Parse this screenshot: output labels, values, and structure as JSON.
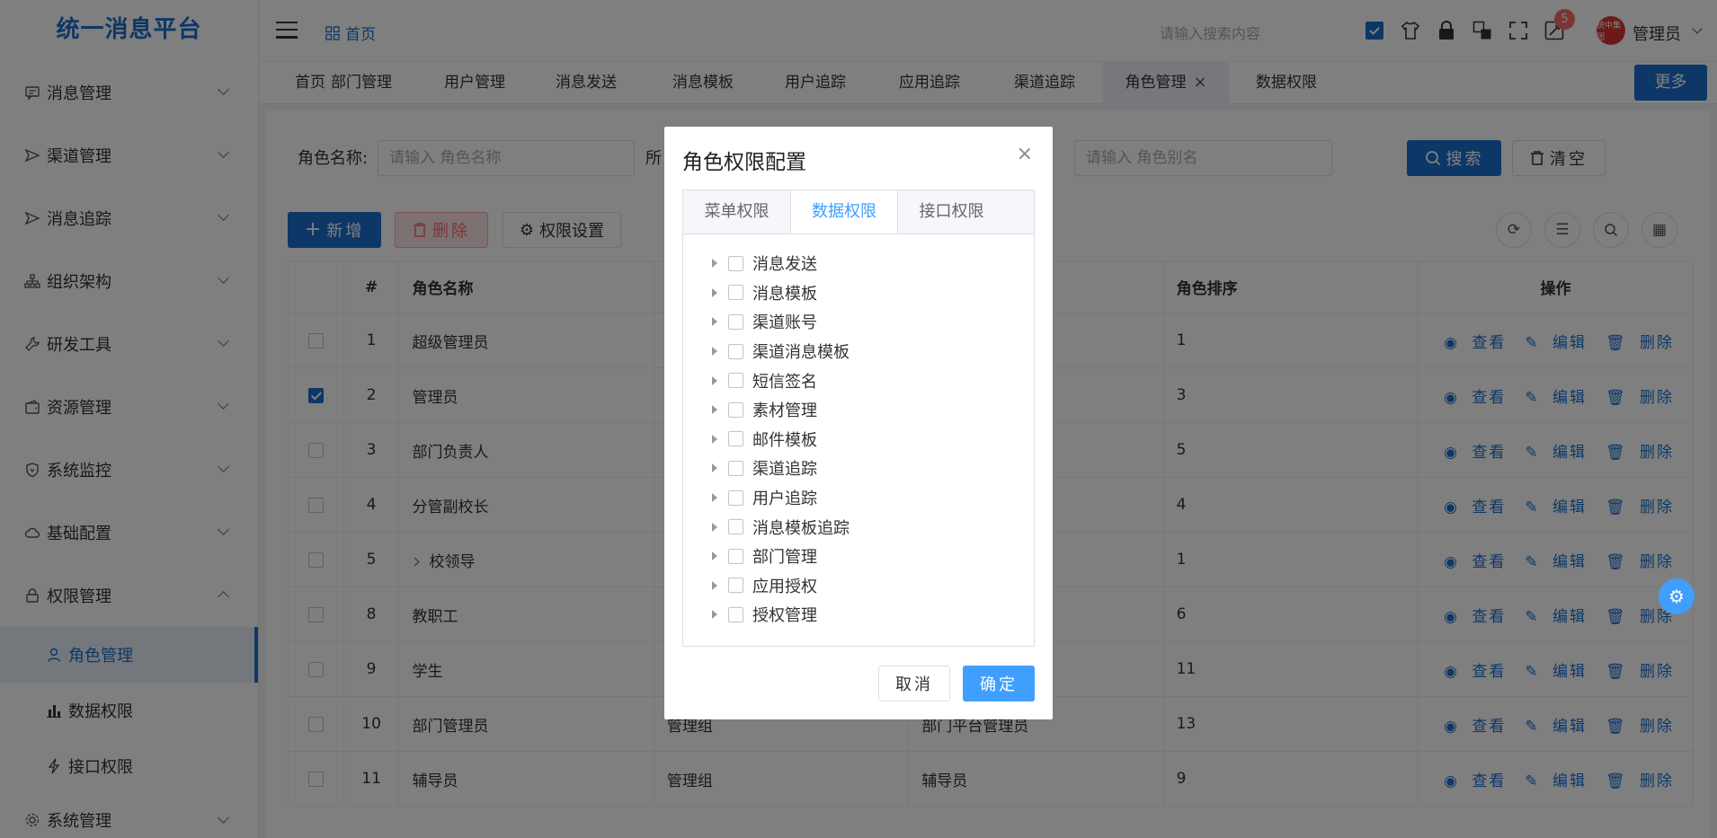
{
  "app": {
    "title": "统一消息平台"
  },
  "sidebar": {
    "items": [
      {
        "label": "消息管理",
        "icon": "message-icon"
      },
      {
        "label": "渠道管理",
        "icon": "send-icon"
      },
      {
        "label": "消息追踪",
        "icon": "send-icon"
      },
      {
        "label": "组织架构",
        "icon": "org-icon"
      },
      {
        "label": "研发工具",
        "icon": "wrench-icon"
      },
      {
        "label": "资源管理",
        "icon": "wallet-icon"
      },
      {
        "label": "系统监控",
        "icon": "shield-icon"
      },
      {
        "label": "基础配置",
        "icon": "cloud-icon"
      },
      {
        "label": "权限管理",
        "icon": "lock-icon"
      }
    ],
    "sub_items": [
      {
        "label": "角色管理",
        "icon": "user-icon"
      },
      {
        "label": "数据权限",
        "icon": "bar-chart-icon"
      },
      {
        "label": "接口权限",
        "icon": "lightning-icon"
      }
    ],
    "last_item": {
      "label": "系统管理",
      "icon": "gear-icon"
    }
  },
  "header": {
    "breadcrumb": "首页",
    "search_placeholder": "请输入搜索内容",
    "notification_count": "5",
    "avatar_text": "统中集团",
    "user_name": "管理员"
  },
  "tabs": {
    "items": [
      "首页",
      "部门管理",
      "用户管理",
      "消息发送",
      "消息模板",
      "用户追踪",
      "应用追踪",
      "渠道追踪",
      "角色管理",
      "数据权限"
    ],
    "active": "角色管理",
    "close_glyph": "×",
    "more_label": "更多"
  },
  "search_form": {
    "role_name_label": "角色名称:",
    "role_name_placeholder": "请输入 角色名称",
    "group_label_partial": "所",
    "alias_label_partial": "名:",
    "alias_placeholder": "请输入 角色别名",
    "search_label": "搜索",
    "clear_label": "清空"
  },
  "toolbar": {
    "add_label": "新增",
    "delete_label": "删除",
    "permission_label": "权限设置"
  },
  "table": {
    "headers": {
      "index": "#",
      "role_name": "角色名称",
      "sort": "角色排序",
      "ops": "操作"
    },
    "rows": [
      {
        "idx": "1",
        "name": "超级管理员",
        "group": "",
        "alias": "",
        "sort": "1",
        "checked": false
      },
      {
        "idx": "2",
        "name": "管理员",
        "group": "",
        "alias": "",
        "sort": "3",
        "checked": true
      },
      {
        "idx": "3",
        "name": "部门负责人",
        "group": "",
        "alias": "",
        "sort": "5",
        "checked": false
      },
      {
        "idx": "4",
        "name": "分管副校长",
        "group": "",
        "alias": "",
        "sort": "4",
        "checked": false
      },
      {
        "idx": "5",
        "name": "校领导",
        "group": "",
        "alias": "",
        "sort": "1",
        "checked": false,
        "expandable": true
      },
      {
        "idx": "8",
        "name": "教职工",
        "group": "",
        "alias": "",
        "sort": "6",
        "checked": false
      },
      {
        "idx": "9",
        "name": "学生",
        "group": "",
        "alias": "",
        "sort": "11",
        "checked": false
      },
      {
        "idx": "10",
        "name": "部门管理员",
        "group": "管理组",
        "alias": "部门平台管理员",
        "sort": "13",
        "checked": false
      },
      {
        "idx": "11",
        "name": "辅导员",
        "group": "管理组",
        "alias": "辅导员",
        "sort": "9",
        "checked": false
      }
    ],
    "ops": {
      "view": "查看",
      "edit": "编辑",
      "delete": "删除"
    }
  },
  "dialog": {
    "title": "角色权限配置",
    "tabs": [
      "菜单权限",
      "数据权限",
      "接口权限"
    ],
    "active_tab": "数据权限",
    "tree": [
      "消息发送",
      "消息模板",
      "渠道账号",
      "渠道消息模板",
      "短信签名",
      "素材管理",
      "邮件模板",
      "渠道追踪",
      "用户追踪",
      "消息模板追踪",
      "部门管理",
      "应用授权",
      "授权管理"
    ],
    "cancel_label": "取消",
    "ok_label": "确定"
  },
  "colors": {
    "primary": "#1a6fce",
    "dialog_primary": "#409eff",
    "danger": "#f56c6c"
  }
}
